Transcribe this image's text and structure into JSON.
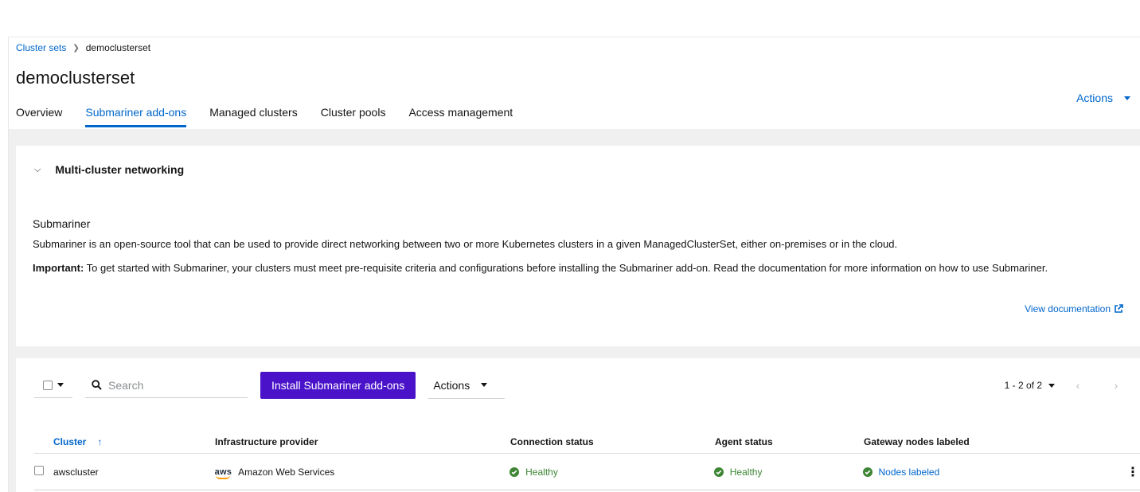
{
  "breadcrumb": {
    "parent": "Cluster sets",
    "current": "democlusterset"
  },
  "page": {
    "title": "democlusterset",
    "actions_label": "Actions"
  },
  "tabs": [
    {
      "label": "Overview"
    },
    {
      "label": "Submariner add-ons"
    },
    {
      "label": "Managed clusters"
    },
    {
      "label": "Cluster pools"
    },
    {
      "label": "Access management"
    }
  ],
  "networking": {
    "header": "Multi-cluster networking",
    "subtitle": "Submariner",
    "description": "Submariner is an open-source tool that can be used to provide direct networking between two or more Kubernetes clusters in a given ManagedClusterSet, either on-premises or in the cloud.",
    "important_label": "Important:",
    "important_text": " To get started with Submariner, your clusters must meet pre-requisite criteria and configurations before installing the Submariner add-on. Read the documentation for more information on how to use Submariner.",
    "view_doc": "View documentation"
  },
  "toolbar": {
    "search_placeholder": "Search",
    "install_button": "Install Submariner add-ons",
    "actions_label": "Actions",
    "pagination": "1 - 2 of 2"
  },
  "table": {
    "headers": {
      "cluster": "Cluster",
      "infra": "Infrastructure provider",
      "connection": "Connection status",
      "agent": "Agent status",
      "gateway": "Gateway nodes labeled"
    },
    "rows": [
      {
        "cluster": "awscluster",
        "provider_logo": "aws",
        "provider": "Amazon Web Services",
        "connection": "Healthy",
        "agent": "Healthy",
        "gateway": "Nodes labeled"
      }
    ]
  },
  "colors": {
    "accent": "#0066cc",
    "primary_button": "#4a12c9",
    "success": "#3e8635"
  }
}
